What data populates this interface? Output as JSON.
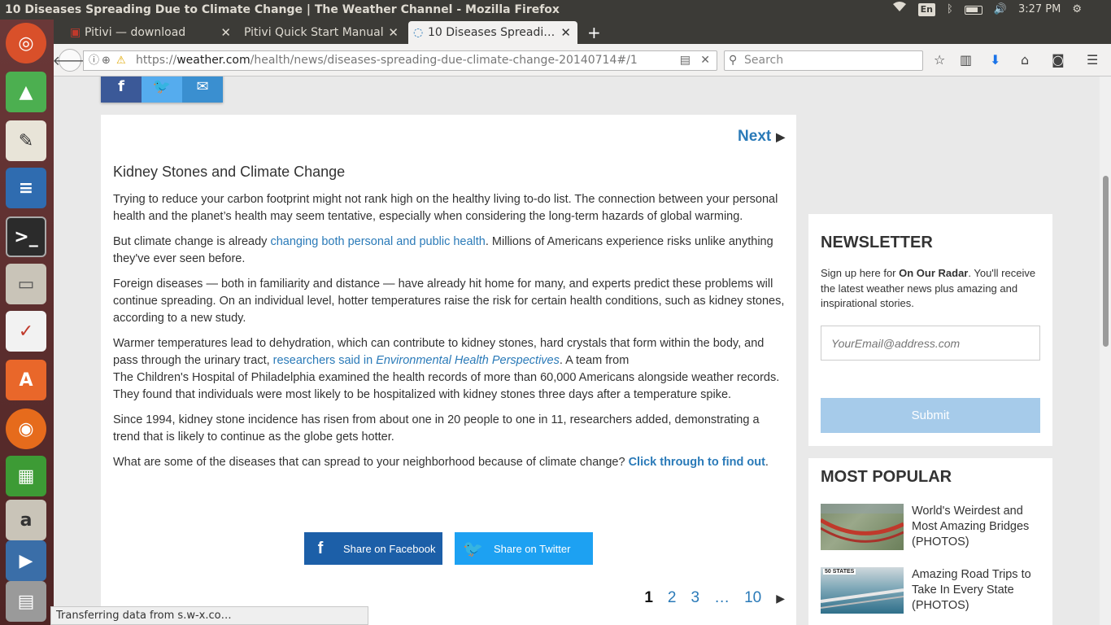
{
  "window": {
    "title": "10 Diseases Spreading Due to Climate Change | The Weather Channel - Mozilla Firefox"
  },
  "tray": {
    "keyboard": "En",
    "time": "3:27 PM",
    "icons": [
      "wifi-icon",
      "bluetooth-icon",
      "battery-icon",
      "volume-icon",
      "gear-icon"
    ]
  },
  "tabs": [
    {
      "label": "Pitivi — download"
    },
    {
      "label": "Pitivi Quick Start Manual"
    },
    {
      "label": "10 Diseases Spreadi…"
    }
  ],
  "url": {
    "scheme": "https://",
    "host": "weather.com",
    "path": "/health/news/diseases-spreading-due-climate-change-20140714#/1"
  },
  "search": {
    "placeholder": "Search"
  },
  "article": {
    "next_label": "Next",
    "title": "Kidney Stones and Climate Change",
    "p1": "Trying to reduce your carbon footprint might not rank high on the healthy living to-do list. The connection between your personal health and the planet’s health may seem tentative, especially when considering the long-term hazards of global warming.",
    "p2_before": "But climate change is already ",
    "p2_link": "changing both personal and public health",
    "p2_after": ". Millions of Americans experience risks unlike anything they've ever seen before.",
    "p3": "Foreign diseases — both in familiarity and distance — have already hit home for many, and experts predict these problems will continue spreading. On an individual level, hotter temperatures raise the risk for certain health conditions, such as kidney stones, according to a new study.",
    "p4_before": "Warmer temperatures lead to dehydration, which can contribute to kidney stones, hard crystals that form within the body, and pass through the urinary tract, ",
    "p4_link_a": "researchers said in ",
    "p4_link_b": "Environmental Health Perspectives",
    "p4_after_1": ". A team from",
    "p4_after_2": "The Children's Hospital of Philadelphia examined the health records of more than 60,000 Americans alongside weather records. They found that individuals were most likely to be hospitalized with kidney stones three days after a temperature spike.",
    "p5": "Since 1994, kidney stone incidence has risen from about one in 20 people to one in 11, researchers added, demonstrating a trend that is likely to continue as the globe gets hotter.",
    "p6_before": "What are some of the diseases that can spread to your neighborhood because of climate change? ",
    "p6_link": "Click through to find out",
    "p6_after": ".",
    "share_facebook": "Share on Facebook",
    "share_twitter": "Share on Twitter",
    "pages": [
      "1",
      "2",
      "3",
      "…",
      "10"
    ]
  },
  "newsletter": {
    "title": "NEWSLETTER",
    "desc_before": "Sign up here for ",
    "desc_bold": "On Our Radar",
    "desc_after": ". You'll receive the latest weather news plus amazing and inspirational stories.",
    "email_placeholder": "YourEmail@address.com",
    "submit": "Submit"
  },
  "popular": {
    "title": "MOST POPULAR",
    "items": [
      {
        "text": "World's Weirdest and Most Amazing Bridges (PHOTOS)"
      },
      {
        "text": "Amazing Road Trips to Take In Every State (PHOTOS)",
        "badge": "50 STATES"
      }
    ]
  },
  "status": "Transferring data from s.w-x.co…",
  "colors": {
    "link": "#2a7ab8",
    "facebook": "#1c5fa8",
    "twitter": "#1da1f2",
    "submit": "#a6cbea",
    "launcher": "#5b2a2a"
  }
}
